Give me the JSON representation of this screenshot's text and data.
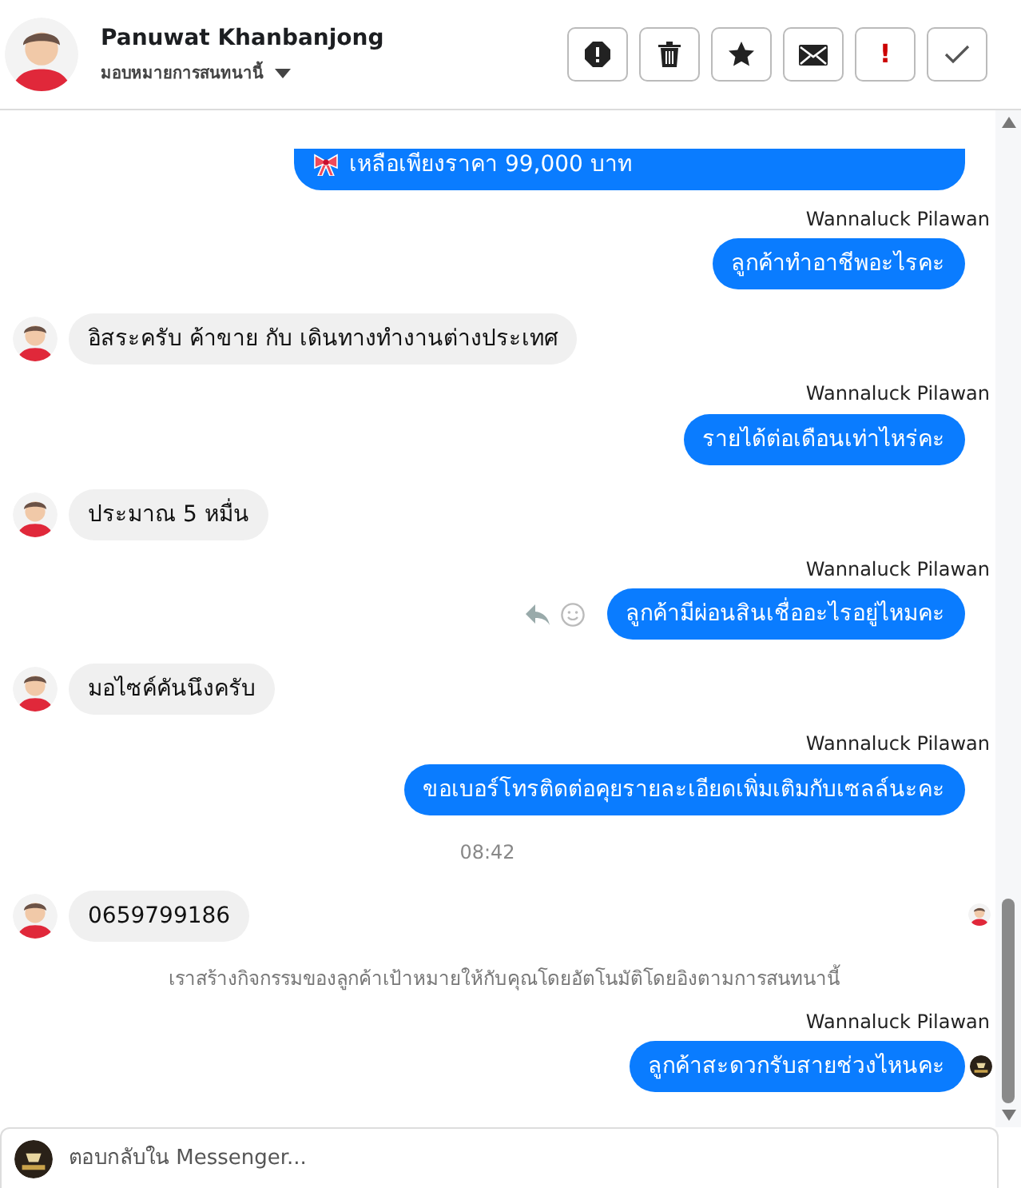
{
  "header": {
    "name": "Panuwat Khanbanjong",
    "assign_label": "มอบหมายการสนทนานี้",
    "actions": [
      {
        "kind": "spam"
      },
      {
        "kind": "delete"
      },
      {
        "kind": "star"
      },
      {
        "kind": "mail"
      },
      {
        "kind": "text",
        "label": "!"
      },
      {
        "kind": "done"
      }
    ]
  },
  "messages": [
    {
      "kind": "sent",
      "lines": [
        "เหลือเพียงราคา 99,000 บาท"
      ],
      "ribbon": true,
      "cut_top": true
    },
    {
      "kind": "sent",
      "sender": "Wannaluck Pilawan",
      "text": "ลูกค้าทำอาชีพอะไรคะ"
    },
    {
      "kind": "received",
      "text": "อิสระครับ ค้าขาย กับ เดินทางทำงานต่างประเทศ"
    },
    {
      "kind": "sent",
      "sender": "Wannaluck Pilawan",
      "text": "รายได้ต่อเดือนเท่าไหร่คะ"
    },
    {
      "kind": "received",
      "text": "ประมาณ 5 หมื่น"
    },
    {
      "kind": "sent",
      "sender": "Wannaluck Pilawan",
      "text": "ลูกค้ามีผ่อนสินเชื่ออะไรอยู่ไหมคะ",
      "hover_actions": true
    },
    {
      "kind": "received",
      "text": "มอไซค์คันนึงครับ"
    },
    {
      "kind": "sent",
      "sender": "Wannaluck Pilawan",
      "text": "ขอเบอร์โทรติดต่อคุยรายละเอียดเพิ่มเติมกับเซลล์นะคะ"
    },
    {
      "kind": "time",
      "text": "08:42"
    },
    {
      "kind": "received",
      "text": "0659799186",
      "seen": true
    },
    {
      "kind": "notice",
      "text": "เราสร้างกิจกรรมของลูกค้าเป้าหมายให้กับคุณโดยอัตโนมัติโดยอิงตามการสนทนานี้"
    },
    {
      "kind": "sent",
      "sender": "Wannaluck Pilawan",
      "text": "ลูกค้าสะดวกรับสายช่วงไหนคะ",
      "seen": true
    }
  ],
  "composer": {
    "placeholder": "ตอบกลับใน Messenger..."
  }
}
